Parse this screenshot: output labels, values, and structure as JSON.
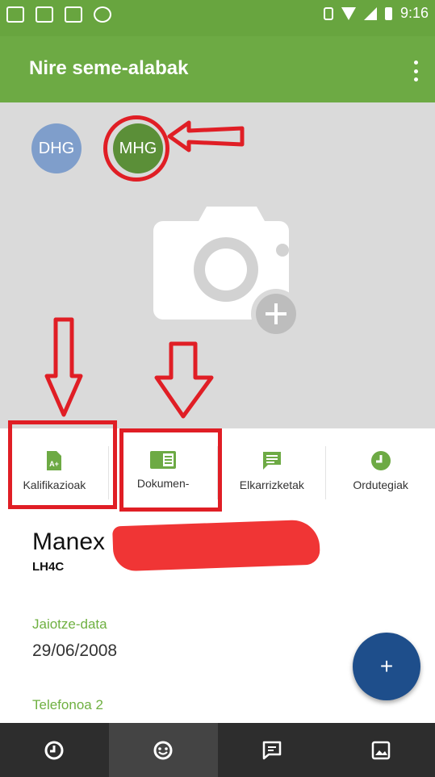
{
  "status_bar": {
    "time": "9:16",
    "icons": [
      "mail-icon",
      "mail-icon",
      "image-icon",
      "whatsapp-icon",
      "vibrate-icon",
      "wifi-icon",
      "signal-icon",
      "battery-icon"
    ]
  },
  "app_bar": {
    "title": "Nire seme-alabak",
    "menu_icon": "more-vert-icon"
  },
  "children": [
    {
      "initials": "DHG",
      "color": "#7f9ecb"
    },
    {
      "initials": "MHG",
      "color": "#5b8f38"
    }
  ],
  "photo": {
    "icon": "camera-add-icon"
  },
  "tabs": [
    {
      "label": "Kalifikazioak",
      "icon": "grade-document-icon"
    },
    {
      "label": "Dokumen-",
      "icon": "folder-document-icon"
    },
    {
      "label": "Elkarrizketak",
      "icon": "chat-icon"
    },
    {
      "label": "Ordutegiak",
      "icon": "clock-icon"
    }
  ],
  "student": {
    "first_name": "Manex",
    "group": "LH4C"
  },
  "fields": [
    {
      "label": "Jaiotze-data",
      "value": "29/06/2008"
    },
    {
      "label": "Telefonoa 2",
      "value": ""
    }
  ],
  "fab": {
    "label": "+"
  },
  "bottom_nav": [
    {
      "icon": "clock-icon",
      "active": false
    },
    {
      "icon": "smiley-icon",
      "active": true
    },
    {
      "icon": "message-icon",
      "active": false
    },
    {
      "icon": "image-icon",
      "active": false
    }
  ],
  "colors": {
    "app_green": "#6daa44",
    "annotation_red": "#e01e25",
    "fab_blue": "#1e4e8b",
    "label_green": "#6fb041"
  }
}
